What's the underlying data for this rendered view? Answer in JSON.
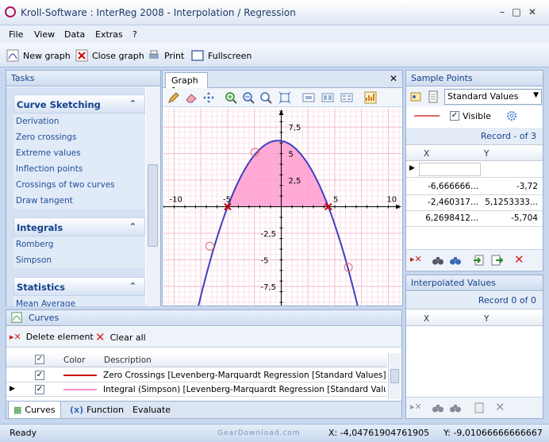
{
  "window": {
    "title": "Kroll-Software : InterReg 2008 - Interpolation / Regression"
  },
  "menu": [
    "File",
    "View",
    "Data",
    "Extras",
    "?"
  ],
  "toolbar": {
    "new_graph": "New graph",
    "close_graph": "Close graph",
    "print": "Print",
    "fullscreen": "Fullscreen"
  },
  "tasks": {
    "title": "Tasks",
    "groups": [
      {
        "title": "Curve Sketching",
        "items": [
          "Derivation",
          "Zero crossings",
          "Extreme values",
          "Inflection points",
          "Crossings of two curves",
          "Draw tangent"
        ]
      },
      {
        "title": "Integrals",
        "items": [
          "Romberg",
          "Simpson"
        ]
      },
      {
        "title": "Statistics",
        "items": [
          "Mean Average"
        ]
      }
    ]
  },
  "graph": {
    "tab": "Graph 1",
    "x_ticks": [
      "-10",
      "-5",
      "5",
      "10"
    ],
    "y_ticks": [
      "7,5",
      "5",
      "2,5",
      "-2,5",
      "-5",
      "-7,5"
    ]
  },
  "samples": {
    "title": "Sample Points",
    "dataset": "Standard Values",
    "visible_label": "Visible",
    "visible": true,
    "record": "Record - of 3",
    "col_x": "X",
    "col_y": "Y",
    "rows": [
      {
        "x": "-6,666666...",
        "y": "-3,72"
      },
      {
        "x": "-2,460317...",
        "y": "5,1253333..."
      },
      {
        "x": "6,2698412...",
        "y": "-5,704"
      }
    ]
  },
  "interp": {
    "title": "Interpolated Values",
    "record": "Record 0 of 0",
    "col_x": "X",
    "col_y": "Y"
  },
  "curves": {
    "title": "Curves",
    "delete": "Delete element",
    "clear": "Clear all",
    "col_color": "Color",
    "col_desc": "Description",
    "rows": [
      {
        "desc": "Zero Crossings [Levenberg-Marquardt Regression [Standard Values]: P...",
        "color": "#cc0000"
      },
      {
        "desc": "Integral (Simpson) [Levenberg-Marquardt Regression [Standard Values...",
        "color": "#ff8fc8"
      }
    ],
    "tabs": [
      "Curves",
      "Function",
      "Evaluate"
    ]
  },
  "status": {
    "ready": "Ready",
    "x": "X: -4,04761904761905",
    "y": "Y: -9,01066666666667",
    "watermark": "GearDownload.com"
  },
  "colors": {
    "accent": "#15428b",
    "curve": "#3f3fbf",
    "fill": "#ff9ccf",
    "marker": "#cc0000"
  },
  "chart_data": {
    "type": "line",
    "x_range": [
      -11,
      11.3
    ],
    "y_range": [
      -9.3,
      9.3
    ],
    "curve": {
      "description": "regression parabola",
      "points": [
        [
          -5,
          0
        ],
        [
          0,
          6.2
        ],
        [
          4.4,
          0
        ]
      ]
    },
    "integral_area": {
      "from": -5,
      "to": 4.4
    },
    "zero_crossings": [
      [
        -5,
        0
      ],
      [
        4.4,
        0
      ]
    ],
    "sample_points": [
      [
        -6.6667,
        -3.72
      ],
      [
        -2.4603,
        5.1253
      ],
      [
        6.2698,
        -5.704
      ]
    ]
  }
}
